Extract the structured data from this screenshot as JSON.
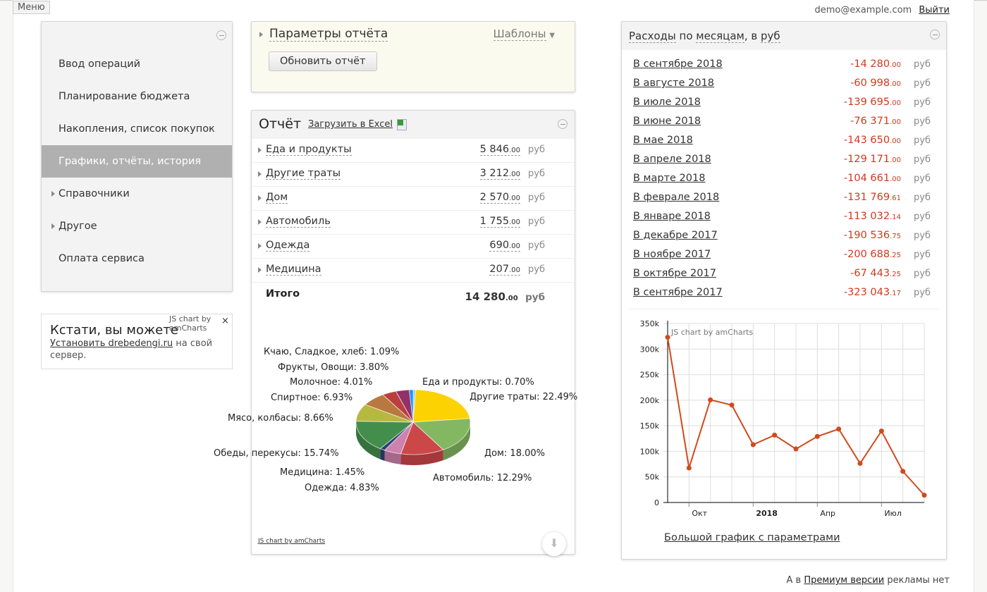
{
  "topbar": {
    "menu": "Меню",
    "user": "demo@example.com",
    "logout": "Выйти"
  },
  "sidebar": {
    "items": [
      {
        "label": "Ввод операций",
        "active": false,
        "expandable": false
      },
      {
        "label": "Планирование бюджета",
        "active": false,
        "expandable": false
      },
      {
        "label": "Накопления, список покупок",
        "active": false,
        "expandable": false
      },
      {
        "label": "Графики, отчёты, история",
        "active": true,
        "expandable": false
      },
      {
        "label": "Справочники",
        "active": false,
        "expandable": true
      },
      {
        "label": "Другое",
        "active": false,
        "expandable": true
      },
      {
        "label": "Оплата сервиса",
        "active": false,
        "expandable": false
      }
    ]
  },
  "widget": {
    "title": "Кстати, вы можете",
    "link": "Установить drebedengi.ru",
    "rest": " на свой сервер.",
    "credit": "JS chart by amCharts",
    "close": "×"
  },
  "params": {
    "title": "Параметры отчёта",
    "templates": "Шаблоны",
    "refresh": "Обновить отчёт"
  },
  "report": {
    "title": "Отчёт",
    "excel": "Загрузить в Excel",
    "currency": "руб",
    "rows": [
      {
        "name": "Еда и продукты",
        "int": "5 846",
        "dec": ".00"
      },
      {
        "name": "Другие траты",
        "int": "3 212",
        "dec": ".00"
      },
      {
        "name": "Дом",
        "int": "2 570",
        "dec": ".00"
      },
      {
        "name": "Автомобиль",
        "int": "1 755",
        "dec": ".00"
      },
      {
        "name": "Одежда",
        "int": "690",
        "dec": ".00"
      },
      {
        "name": "Медицина",
        "int": "207",
        "dec": ".00"
      }
    ],
    "total_label": "Итого",
    "total_int": "14 280",
    "total_dec": ".00",
    "credit": "JS chart by amCharts"
  },
  "expenses": {
    "title_a": "Расходы",
    "title_b": " по ",
    "title_c": "месяцам",
    "title_d": ", в ",
    "title_e": "руб",
    "currency": "руб",
    "rows": [
      {
        "month": "В сентябре 2018",
        "int": "-14 280",
        "dec": ".00"
      },
      {
        "month": "В августе 2018",
        "int": "-60 998",
        "dec": ".00"
      },
      {
        "month": "В июле 2018",
        "int": "-139 695",
        "dec": ".00"
      },
      {
        "month": "В июне 2018",
        "int": "-76 371",
        "dec": ".00"
      },
      {
        "month": "В мае 2018",
        "int": "-143 650",
        "dec": ".00"
      },
      {
        "month": "В апреле 2018",
        "int": "-129 171",
        "dec": ".00"
      },
      {
        "month": "В марте 2018",
        "int": "-104 661",
        "dec": ".00"
      },
      {
        "month": "В феврале 2018",
        "int": "-131 769",
        "dec": ".61"
      },
      {
        "month": "В январе 2018",
        "int": "-113 032",
        "dec": ".14"
      },
      {
        "month": "В декабре 2017",
        "int": "-190 536",
        "dec": ".75"
      },
      {
        "month": "В ноябре 2017",
        "int": "-200 688",
        "dec": ".25"
      },
      {
        "month": "В октябре 2017",
        "int": "-67 443",
        "dec": ".25"
      },
      {
        "month": "В сентябре 2017",
        "int": "-323 043",
        "dec": ".17"
      }
    ],
    "big_chart_link": "Большой график с параметрами"
  },
  "footer": {
    "a": "А в ",
    "link": "Премиум версии",
    "b": " рекламы нет"
  },
  "chart_data": [
    {
      "type": "pie",
      "credit": "JS chart by amCharts",
      "slices": [
        {
          "label": "Еда и продукты: 0.70%",
          "value": 0.7,
          "color": "#8fd3f5"
        },
        {
          "label": "Другие траты: 22.49%",
          "value": 22.49,
          "color": "#fcd202"
        },
        {
          "label": "Дом: 18.00%",
          "value": 18.0,
          "color": "#84b761"
        },
        {
          "label": "Автомобиль: 12.29%",
          "value": 12.29,
          "color": "#cc4748"
        },
        {
          "label": "Одежда: 4.83%",
          "value": 4.83,
          "color": "#cd82ad"
        },
        {
          "label": "Медицина: 1.45%",
          "value": 1.45,
          "color": "#2f4074"
        },
        {
          "label": "Обеды, перекусы: 15.74%",
          "value": 15.74,
          "color": "#448e4d"
        },
        {
          "label": "Мясо, колбасы: 8.66%",
          "value": 8.66,
          "color": "#b7b83f"
        },
        {
          "label": "Спиртное: 6.93%",
          "value": 6.93,
          "color": "#b9783f"
        },
        {
          "label": "Молочное: 4.01%",
          "value": 4.01,
          "color": "#b93e3d"
        },
        {
          "label": "Фрукты, Овощи: 3.80%",
          "value": 3.8,
          "color": "#913167"
        },
        {
          "label": "Кчаю, Сладкое, хлеб: 1.09%",
          "value": 1.09,
          "color": "#1e90ff"
        }
      ]
    },
    {
      "type": "line",
      "credit": "JS chart by amCharts",
      "color": "#d04a1c",
      "x": [
        "2017-09",
        "2017-10",
        "2017-11",
        "2017-12",
        "2018-01",
        "2018-02",
        "2018-03",
        "2018-04",
        "2018-05",
        "2018-06",
        "2018-07",
        "2018-08",
        "2018-09"
      ],
      "y": [
        323043.17,
        67443.25,
        200688.25,
        190536.75,
        113032.14,
        131769.61,
        104661,
        129171,
        143650,
        76371,
        139695,
        60998,
        14280
      ],
      "ylim": [
        0,
        350000
      ],
      "yticks": [
        "0",
        "50k",
        "100k",
        "150k",
        "200k",
        "250k",
        "300k",
        "350k"
      ],
      "xticks": [
        {
          "label": "Окт",
          "at": "2017-10",
          "bold": false
        },
        {
          "label": "2018",
          "at": "2018-01",
          "bold": true
        },
        {
          "label": "Апр",
          "at": "2018-04",
          "bold": false
        },
        {
          "label": "Июл",
          "at": "2018-07",
          "bold": false
        }
      ],
      "grid": true
    }
  ]
}
